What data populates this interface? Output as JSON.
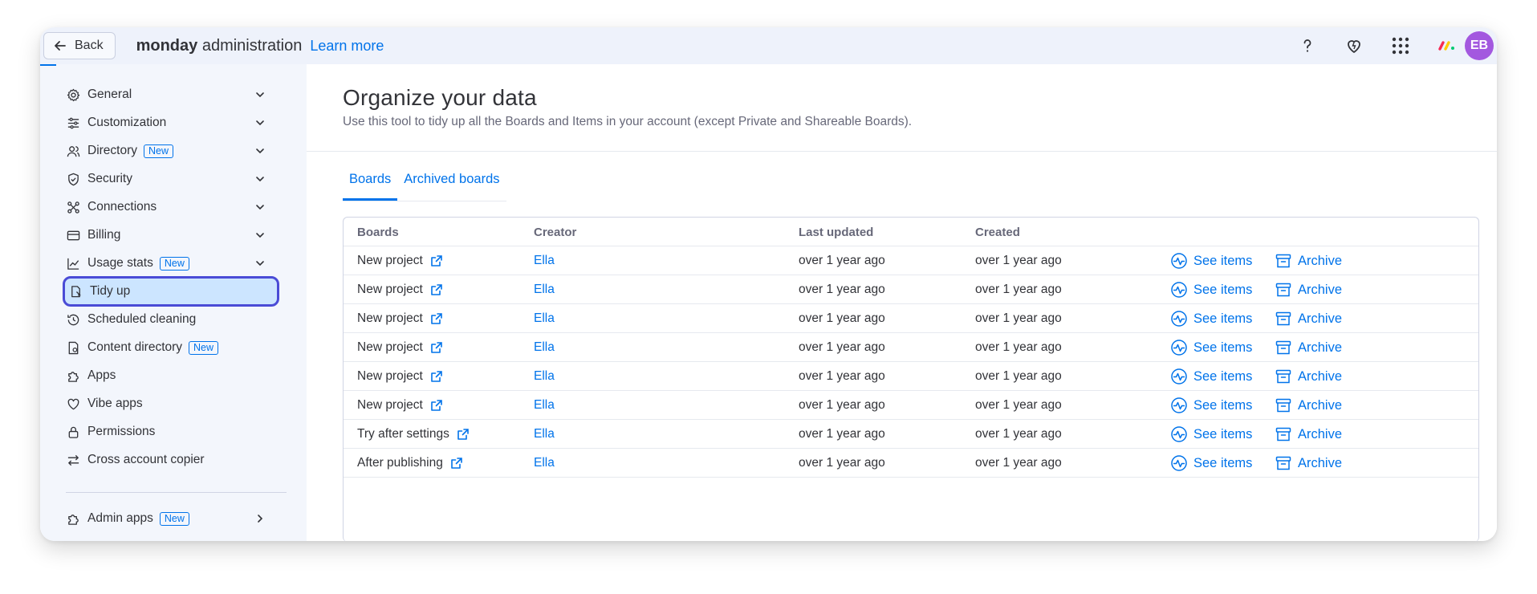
{
  "topbar": {
    "back_label": "Back",
    "brand_bold": "monday",
    "brand_rest": " administration",
    "learn_more": "Learn more",
    "avatar_initials": "EB"
  },
  "sidebar": {
    "items": [
      {
        "label": "General",
        "icon": "gear-icon",
        "badge": "",
        "chevron": "down"
      },
      {
        "label": "Customization",
        "icon": "sliders-icon",
        "badge": "",
        "chevron": "down"
      },
      {
        "label": "Directory",
        "icon": "users-icon",
        "badge": "New",
        "chevron": "down"
      },
      {
        "label": "Security",
        "icon": "shield-icon",
        "badge": "",
        "chevron": "down"
      },
      {
        "label": "Connections",
        "icon": "connections-icon",
        "badge": "",
        "chevron": "down"
      },
      {
        "label": "Billing",
        "icon": "credit-card-icon",
        "badge": "",
        "chevron": "down"
      },
      {
        "label": "Usage stats",
        "icon": "chart-icon",
        "badge": "New",
        "chevron": "down"
      },
      {
        "label": "Tidy up",
        "icon": "broom-icon",
        "badge": "",
        "chevron": ""
      },
      {
        "label": "Scheduled cleaning",
        "icon": "clock-icon",
        "badge": "",
        "chevron": ""
      },
      {
        "label": "Content directory",
        "icon": "document-icon",
        "badge": "New",
        "chevron": ""
      },
      {
        "label": "Apps",
        "icon": "puzzle-icon",
        "badge": "",
        "chevron": ""
      },
      {
        "label": "Vibe apps",
        "icon": "heart-icon",
        "badge": "",
        "chevron": ""
      },
      {
        "label": "Permissions",
        "icon": "lock-icon",
        "badge": "",
        "chevron": ""
      },
      {
        "label": "Cross account copier",
        "icon": "swap-icon",
        "badge": "",
        "chevron": ""
      }
    ],
    "admin_apps": {
      "label": "Admin apps",
      "badge": "New"
    }
  },
  "main": {
    "title": "Organize your data",
    "subtitle": "Use this tool to tidy up all the Boards and Items in your account (except Private and Shareable Boards).",
    "tabs": [
      "Boards",
      "Archived boards"
    ],
    "table": {
      "headers": [
        "Boards",
        "Creator",
        "Last updated",
        "Created"
      ],
      "see_items_label": "See items",
      "archive_label": "Archive",
      "rows": [
        {
          "board": "New project",
          "creator": "Ella",
          "updated": "over 1 year ago",
          "created": "over 1 year ago"
        },
        {
          "board": "New project",
          "creator": "Ella",
          "updated": "over 1 year ago",
          "created": "over 1 year ago"
        },
        {
          "board": "New project",
          "creator": "Ella",
          "updated": "over 1 year ago",
          "created": "over 1 year ago"
        },
        {
          "board": "New project",
          "creator": "Ella",
          "updated": "over 1 year ago",
          "created": "over 1 year ago"
        },
        {
          "board": "New project",
          "creator": "Ella",
          "updated": "over 1 year ago",
          "created": "over 1 year ago"
        },
        {
          "board": "New project",
          "creator": "Ella",
          "updated": "over 1 year ago",
          "created": "over 1 year ago"
        },
        {
          "board": "Try after settings",
          "creator": "Ella",
          "updated": "over 1 year ago",
          "created": "over 1 year ago"
        },
        {
          "board": "After publishing",
          "creator": "Ella",
          "updated": "over 1 year ago",
          "created": "over 1 year ago"
        }
      ]
    }
  },
  "colors": {
    "accent": "#0073ea",
    "avatar": "#a358df",
    "active_border": "#4a4bd6",
    "active_bg": "#cce5ff"
  }
}
